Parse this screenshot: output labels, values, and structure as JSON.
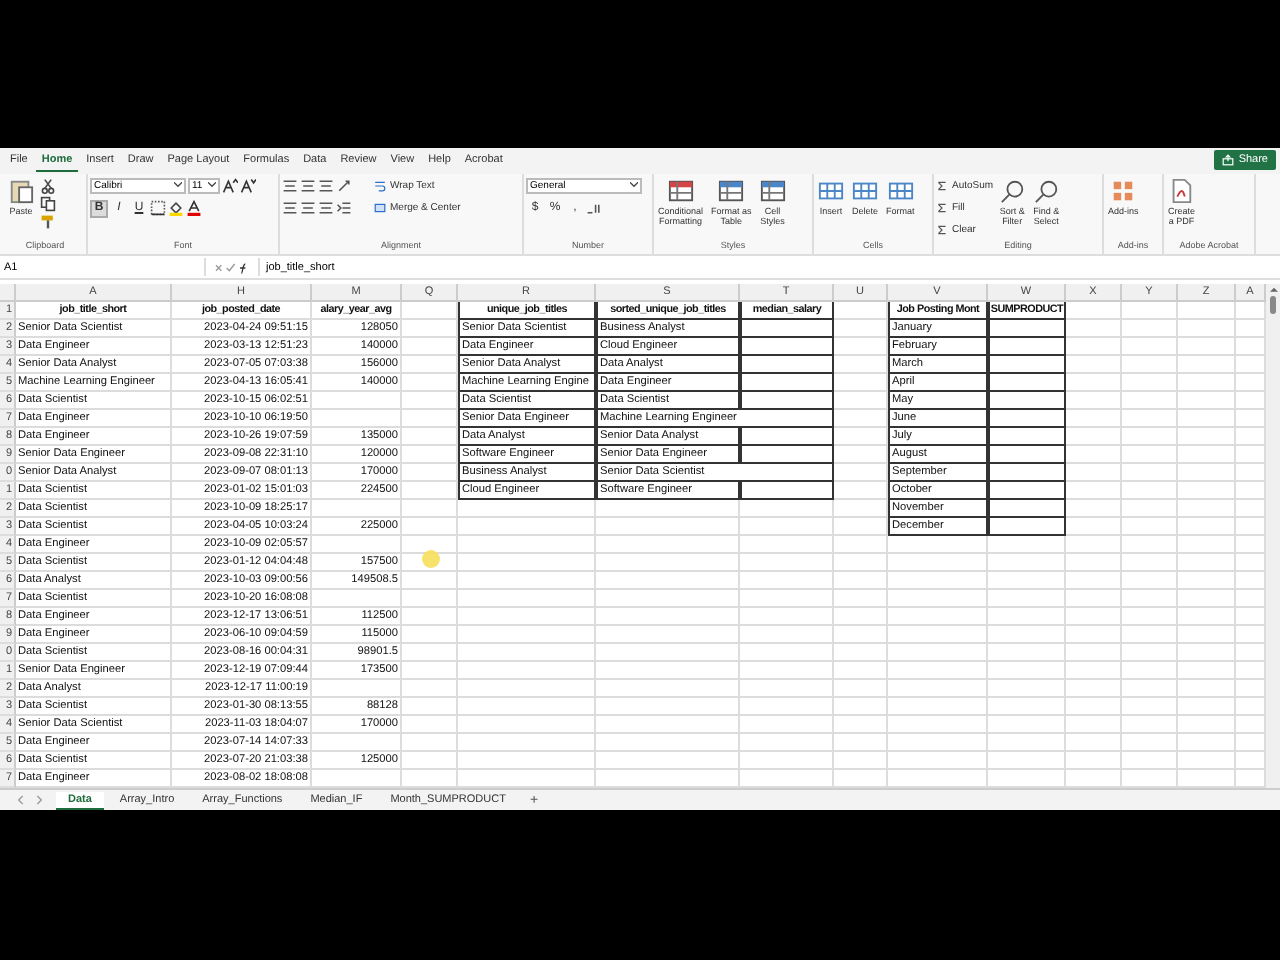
{
  "menu_tabs": [
    {
      "label": "File",
      "selected": false
    },
    {
      "label": "Home",
      "selected": true
    },
    {
      "label": "Insert",
      "selected": false
    },
    {
      "label": "Draw",
      "selected": false
    },
    {
      "label": "Page Layout",
      "selected": false
    },
    {
      "label": "Formulas",
      "selected": false
    },
    {
      "label": "Data",
      "selected": false
    },
    {
      "label": "Review",
      "selected": false
    },
    {
      "label": "View",
      "selected": false
    },
    {
      "label": "Help",
      "selected": false
    },
    {
      "label": "Acrobat",
      "selected": false
    }
  ],
  "share_button": "Share",
  "ribbon": {
    "clipboard": {
      "paste": "Paste",
      "label": "Clipboard"
    },
    "font": {
      "name": "Calibri",
      "size": "11",
      "bold": "B",
      "italic": "I",
      "underline": "U",
      "label": "Font"
    },
    "alignment": {
      "wrap": "Wrap Text",
      "merge": "Merge & Center",
      "label": "Alignment"
    },
    "number": {
      "format": "General",
      "symbols": [
        "$",
        "%",
        ","
      ],
      "label": "Number"
    },
    "styles": {
      "buttons": [
        "Conditional\nFormatting",
        "Format as\nTable",
        "Cell\nStyles"
      ],
      "label": "Styles"
    },
    "cells": {
      "buttons": [
        "Insert",
        "Delete",
        "Format"
      ],
      "label": "Cells"
    },
    "editing": {
      "small": [
        "AutoSum",
        "Fill",
        "Clear"
      ],
      "big": [
        "Sort &\nFilter",
        "Find &\nSelect"
      ],
      "label": "Editing"
    },
    "addins": {
      "button": "Add-ins",
      "label": "Add-ins"
    },
    "acrobat": {
      "button": "Create\na PDF",
      "label": "Adobe Acrobat"
    }
  },
  "formula_bar": {
    "name_box": "A1",
    "formula": "job_title_short"
  },
  "columns": [
    "A",
    "H",
    "M",
    "Q",
    "R",
    "S",
    "T",
    "U",
    "V",
    "W",
    "X",
    "Y",
    "Z",
    "A"
  ],
  "row_numbers": [
    "1",
    "2",
    "3",
    "4",
    "5",
    "6",
    "7",
    "8",
    "9",
    "0",
    "1",
    "2",
    "3",
    "4",
    "5",
    "6",
    "7",
    "8",
    "9",
    "0",
    "1",
    "2",
    "3",
    "4",
    "5",
    "6",
    "7"
  ],
  "data_table": {
    "columns": [
      "job_title_short",
      "job_posted_date",
      "alary_year_avg"
    ],
    "rows": [
      [
        "Senior Data Scientist",
        "2023-04-24 09:51:15",
        "128050"
      ],
      [
        "Data Engineer",
        "2023-03-13 12:51:23",
        "140000"
      ],
      [
        "Senior Data Analyst",
        "2023-07-05 07:03:38",
        "156000"
      ],
      [
        "Machine Learning Engineer",
        "2023-04-13 16:05:41",
        "140000"
      ],
      [
        "Data Scientist",
        "2023-10-15 06:02:51",
        null
      ],
      [
        "Data Engineer",
        "2023-10-10 06:19:50",
        null
      ],
      [
        "Data Engineer",
        "2023-10-26 19:07:59",
        "135000"
      ],
      [
        "Senior Data Engineer",
        "2023-09-08 22:31:10",
        "120000"
      ],
      [
        "Senior Data Analyst",
        "2023-09-07 08:01:13",
        "170000"
      ],
      [
        "Data Scientist",
        "2023-01-02 15:01:03",
        "224500"
      ],
      [
        "Data Scientist",
        "2023-10-09 18:25:17",
        null
      ],
      [
        "Data Scientist",
        "2023-04-05 10:03:24",
        "225000"
      ],
      [
        "Data Engineer",
        "2023-10-09 02:05:57",
        null
      ],
      [
        "Data Scientist",
        "2023-01-12 04:04:48",
        "157500"
      ],
      [
        "Data Analyst",
        "2023-10-03 09:00:56",
        "149508.5"
      ],
      [
        "Data Scientist",
        "2023-10-20 16:08:08",
        null
      ],
      [
        "Data Engineer",
        "2023-12-17 13:06:51",
        "112500"
      ],
      [
        "Data Engineer",
        "2023-06-10 09:04:59",
        "115000"
      ],
      [
        "Data Scientist",
        "2023-08-16 00:04:31",
        "98901.5"
      ],
      [
        "Senior Data Engineer",
        "2023-12-19 07:09:44",
        "173500"
      ],
      [
        "Data Analyst",
        "2023-12-17 11:00:19",
        null
      ],
      [
        "Data Scientist",
        "2023-01-30 08:13:55",
        "88128"
      ],
      [
        "Senior Data Scientist",
        "2023-11-03 18:04:07",
        "170000"
      ],
      [
        "Data Engineer",
        "2023-07-14 14:07:33",
        null
      ],
      [
        "Data Scientist",
        "2023-07-20 21:03:38",
        "125000"
      ],
      [
        "Data Engineer",
        "2023-08-02 18:08:08",
        null
      ]
    ]
  },
  "titles_table": {
    "columns": [
      "unique_job_titles",
      "sorted_unique_job_titles",
      "median_salary"
    ],
    "rows": [
      [
        "Senior Data Scientist",
        "Business Analyst"
      ],
      [
        "Data Engineer",
        "Cloud Engineer"
      ],
      [
        "Senior Data Analyst",
        "Data Analyst"
      ],
      [
        "Machine Learning Engine",
        "Data Engineer"
      ],
      [
        "Data Scientist",
        "Data Scientist"
      ],
      [
        "Senior Data Engineer",
        "Machine Learning Engineer"
      ],
      [
        "Data Analyst",
        "Senior Data Analyst"
      ],
      [
        "Software Engineer",
        "Senior Data Engineer"
      ],
      [
        "Business Analyst",
        "Senior Data Scientist"
      ],
      [
        "Cloud Engineer",
        "Software Engineer"
      ]
    ]
  },
  "month_table": {
    "columns": [
      "Job Posting Mont",
      "SUMPRODUCT"
    ],
    "rows": [
      "January",
      "February",
      "March",
      "April",
      "May",
      "June",
      "July",
      "August",
      "September",
      "October",
      "November",
      "December"
    ]
  },
  "sheet_tabs": [
    {
      "label": "Data",
      "selected": true
    },
    {
      "label": "Array_Intro",
      "selected": false
    },
    {
      "label": "Array_Functions",
      "selected": false
    },
    {
      "label": "Median_IF",
      "selected": false
    },
    {
      "label": "Month_SUMPRODUCT",
      "selected": false
    }
  ],
  "add_sheet": "+"
}
